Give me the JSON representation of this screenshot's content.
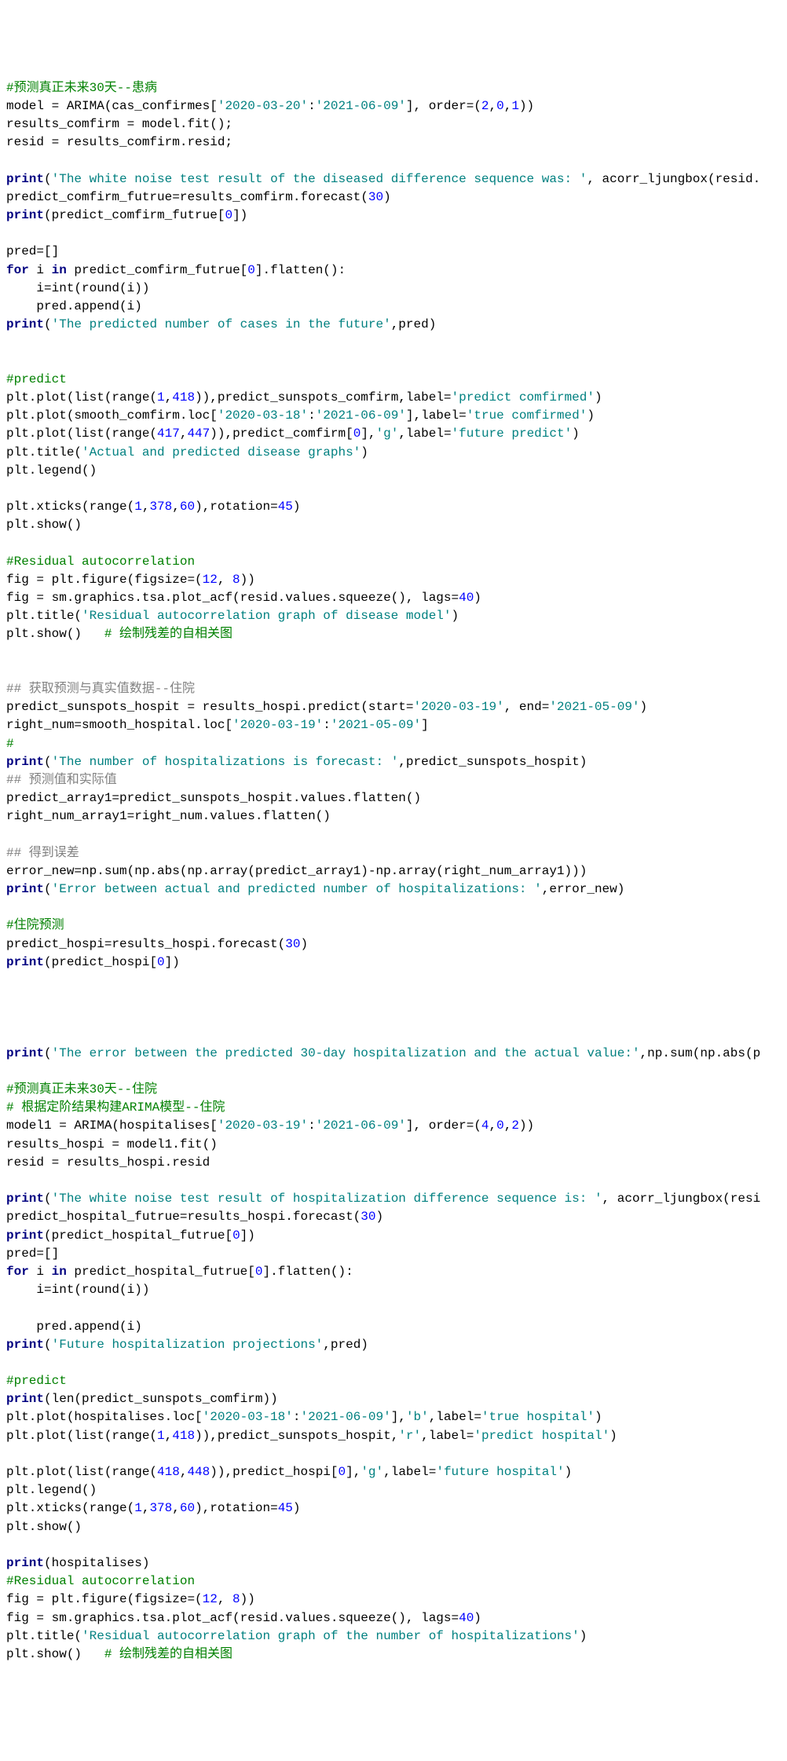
{
  "lines": [
    [
      [
        "c",
        "#预测真正未来30天--患病"
      ]
    ],
    [
      [
        "p",
        "model = ARIMA(cas_confirmes["
      ],
      [
        "s",
        "'2020-03-20'"
      ],
      [
        "p",
        ":"
      ],
      [
        "s",
        "'2021-06-09'"
      ],
      [
        "p",
        "], order=("
      ],
      [
        "n",
        "2"
      ],
      [
        "p",
        ","
      ],
      [
        "n",
        "0"
      ],
      [
        "p",
        ","
      ],
      [
        "n",
        "1"
      ],
      [
        "p",
        "))"
      ]
    ],
    [
      [
        "p",
        "results_comfirm = model.fit();"
      ]
    ],
    [
      [
        "p",
        "resid = results_comfirm.resid;"
      ]
    ],
    [],
    [
      [
        "k",
        "print"
      ],
      [
        "p",
        "("
      ],
      [
        "s",
        "'The white noise test result of the diseased difference sequence was: '"
      ],
      [
        "p",
        ", acorr_ljungbox(resid."
      ]
    ],
    [
      [
        "p",
        "predict_comfirm_futrue=results_comfirm.forecast("
      ],
      [
        "n",
        "30"
      ],
      [
        "p",
        ")"
      ]
    ],
    [
      [
        "k",
        "print"
      ],
      [
        "p",
        "(predict_comfirm_futrue["
      ],
      [
        "n",
        "0"
      ],
      [
        "p",
        "])"
      ]
    ],
    [],
    [
      [
        "p",
        "pred=[]"
      ]
    ],
    [
      [
        "k",
        "for"
      ],
      [
        "p",
        " i "
      ],
      [
        "k",
        "in"
      ],
      [
        "p",
        " predict_comfirm_futrue["
      ],
      [
        "n",
        "0"
      ],
      [
        "p",
        "].flatten():"
      ]
    ],
    [
      [
        "p",
        "    i=int(round(i))"
      ]
    ],
    [
      [
        "p",
        "    pred.append(i)"
      ]
    ],
    [
      [
        "k",
        "print"
      ],
      [
        "p",
        "("
      ],
      [
        "s",
        "'The predicted number of cases in the future'"
      ],
      [
        "p",
        ",pred)"
      ]
    ],
    [],
    [],
    [
      [
        "c",
        "#predict"
      ]
    ],
    [
      [
        "p",
        "plt.plot(list(range("
      ],
      [
        "n",
        "1"
      ],
      [
        "p",
        ","
      ],
      [
        "n",
        "418"
      ],
      [
        "p",
        ")),predict_sunspots_comfirm,label="
      ],
      [
        "s",
        "'predict comfirmed'"
      ],
      [
        "p",
        ")"
      ]
    ],
    [
      [
        "p",
        "plt.plot(smooth_comfirm.loc["
      ],
      [
        "s",
        "'2020-03-18'"
      ],
      [
        "p",
        ":"
      ],
      [
        "s",
        "'2021-06-09'"
      ],
      [
        "p",
        "],label="
      ],
      [
        "s",
        "'true comfirmed'"
      ],
      [
        "p",
        ")"
      ]
    ],
    [
      [
        "p",
        "plt.plot(list(range("
      ],
      [
        "n",
        "417"
      ],
      [
        "p",
        ","
      ],
      [
        "n",
        "447"
      ],
      [
        "p",
        ")),predict_comfirm["
      ],
      [
        "n",
        "0"
      ],
      [
        "p",
        "],"
      ],
      [
        "s",
        "'g'"
      ],
      [
        "p",
        ",label="
      ],
      [
        "s",
        "'future predict'"
      ],
      [
        "p",
        ")"
      ]
    ],
    [
      [
        "p",
        "plt.title("
      ],
      [
        "s",
        "'Actual and predicted disease graphs'"
      ],
      [
        "p",
        ")"
      ]
    ],
    [
      [
        "p",
        "plt.legend()"
      ]
    ],
    [],
    [
      [
        "p",
        "plt.xticks(range("
      ],
      [
        "n",
        "1"
      ],
      [
        "p",
        ","
      ],
      [
        "n",
        "378"
      ],
      [
        "p",
        ","
      ],
      [
        "n",
        "60"
      ],
      [
        "p",
        "),rotation="
      ],
      [
        "n",
        "45"
      ],
      [
        "p",
        ")"
      ]
    ],
    [
      [
        "p",
        "plt.show()"
      ]
    ],
    [],
    [
      [
        "c",
        "#Residual autocorrelation"
      ]
    ],
    [
      [
        "p",
        "fig = plt.figure(figsize=("
      ],
      [
        "n",
        "12"
      ],
      [
        "p",
        ", "
      ],
      [
        "n",
        "8"
      ],
      [
        "p",
        "))"
      ]
    ],
    [
      [
        "p",
        "fig = sm.graphics.tsa.plot_acf(resid.values.squeeze(), lags="
      ],
      [
        "n",
        "40"
      ],
      [
        "p",
        ")"
      ]
    ],
    [
      [
        "p",
        "plt.title("
      ],
      [
        "s",
        "'Residual autocorrelation graph of disease model'"
      ],
      [
        "p",
        ")"
      ]
    ],
    [
      [
        "p",
        "plt.show()   "
      ],
      [
        "c",
        "# 绘制残差的自相关图"
      ]
    ],
    [],
    [],
    [
      [
        "ss",
        "## 获取预测与真实值数据--住院"
      ]
    ],
    [
      [
        "p",
        "predict_sunspots_hospit = results_hospi.predict(start="
      ],
      [
        "s",
        "'2020-03-19'"
      ],
      [
        "p",
        ", end="
      ],
      [
        "s",
        "'2021-05-09'"
      ],
      [
        "p",
        ")"
      ]
    ],
    [
      [
        "p",
        "right_num=smooth_hospital.loc["
      ],
      [
        "s",
        "'2020-03-19'"
      ],
      [
        "p",
        ":"
      ],
      [
        "s",
        "'2021-05-09'"
      ],
      [
        "p",
        "]"
      ]
    ],
    [
      [
        "c",
        "#"
      ]
    ],
    [
      [
        "k",
        "print"
      ],
      [
        "p",
        "("
      ],
      [
        "s",
        "'The number of hospitalizations is forecast: '"
      ],
      [
        "p",
        ",predict_sunspots_hospit)"
      ]
    ],
    [
      [
        "ss",
        "## 预测值和实际值"
      ]
    ],
    [
      [
        "p",
        "predict_array1=predict_sunspots_hospit.values.flatten()"
      ]
    ],
    [
      [
        "p",
        "right_num_array1=right_num.values.flatten()"
      ]
    ],
    [],
    [
      [
        "ss",
        "## 得到误差"
      ]
    ],
    [
      [
        "p",
        "error_new=np.sum(np.abs(np.array(predict_array1)-np.array(right_num_array1)))"
      ]
    ],
    [
      [
        "k",
        "print"
      ],
      [
        "p",
        "("
      ],
      [
        "s",
        "'Error between actual and predicted number of hospitalizations: '"
      ],
      [
        "p",
        ",error_new)"
      ]
    ],
    [],
    [
      [
        "c",
        "#住院预测"
      ]
    ],
    [
      [
        "p",
        "predict_hospi=results_hospi.forecast("
      ],
      [
        "n",
        "30"
      ],
      [
        "p",
        ")"
      ]
    ],
    [
      [
        "k",
        "print"
      ],
      [
        "p",
        "(predict_hospi["
      ],
      [
        "n",
        "0"
      ],
      [
        "p",
        "])"
      ]
    ],
    [],
    [],
    [],
    [],
    [
      [
        "k",
        "print"
      ],
      [
        "p",
        "("
      ],
      [
        "s",
        "'The error between the predicted 30-day hospitalization and the actual value:'"
      ],
      [
        "p",
        ",np.sum(np.abs(p"
      ]
    ],
    [],
    [
      [
        "c",
        "#预测真正未来30天--住院"
      ]
    ],
    [
      [
        "c",
        "# 根据定阶结果构建ARIMA模型--住院"
      ]
    ],
    [
      [
        "p",
        "model1 = ARIMA(hospitalises["
      ],
      [
        "s",
        "'2020-03-19'"
      ],
      [
        "p",
        ":"
      ],
      [
        "s",
        "'2021-06-09'"
      ],
      [
        "p",
        "], order=("
      ],
      [
        "n",
        "4"
      ],
      [
        "p",
        ","
      ],
      [
        "n",
        "0"
      ],
      [
        "p",
        ","
      ],
      [
        "n",
        "2"
      ],
      [
        "p",
        "))"
      ]
    ],
    [
      [
        "p",
        "results_hospi = model1.fit()"
      ]
    ],
    [
      [
        "p",
        "resid = results_hospi.resid"
      ]
    ],
    [],
    [
      [
        "k",
        "print"
      ],
      [
        "p",
        "("
      ],
      [
        "s",
        "'The white noise test result of hospitalization difference sequence is: '"
      ],
      [
        "p",
        ", acorr_ljungbox(resi"
      ]
    ],
    [
      [
        "p",
        "predict_hospital_futrue=results_hospi.forecast("
      ],
      [
        "n",
        "30"
      ],
      [
        "p",
        ")"
      ]
    ],
    [
      [
        "k",
        "print"
      ],
      [
        "p",
        "(predict_hospital_futrue["
      ],
      [
        "n",
        "0"
      ],
      [
        "p",
        "])"
      ]
    ],
    [
      [
        "p",
        "pred=[]"
      ]
    ],
    [
      [
        "k",
        "for"
      ],
      [
        "p",
        " i "
      ],
      [
        "k",
        "in"
      ],
      [
        "p",
        " predict_hospital_futrue["
      ],
      [
        "n",
        "0"
      ],
      [
        "p",
        "].flatten():"
      ]
    ],
    [
      [
        "p",
        "    i=int(round(i))"
      ]
    ],
    [],
    [
      [
        "p",
        "    pred.append(i)"
      ]
    ],
    [
      [
        "k",
        "print"
      ],
      [
        "p",
        "("
      ],
      [
        "s",
        "'Future hospitalization projections'"
      ],
      [
        "p",
        ",pred)"
      ]
    ],
    [],
    [
      [
        "c",
        "#predict"
      ]
    ],
    [
      [
        "k",
        "print"
      ],
      [
        "p",
        "(len(predict_sunspots_comfirm))"
      ]
    ],
    [
      [
        "p",
        "plt.plot(hospitalises.loc["
      ],
      [
        "s",
        "'2020-03-18'"
      ],
      [
        "p",
        ":"
      ],
      [
        "s",
        "'2021-06-09'"
      ],
      [
        "p",
        "],"
      ],
      [
        "s",
        "'b'"
      ],
      [
        "p",
        ",label="
      ],
      [
        "s",
        "'true hospital'"
      ],
      [
        "p",
        ")"
      ]
    ],
    [
      [
        "p",
        "plt.plot(list(range("
      ],
      [
        "n",
        "1"
      ],
      [
        "p",
        ","
      ],
      [
        "n",
        "418"
      ],
      [
        "p",
        ")),predict_sunspots_hospit,"
      ],
      [
        "s",
        "'r'"
      ],
      [
        "p",
        ",label="
      ],
      [
        "s",
        "'predict hospital'"
      ],
      [
        "p",
        ")"
      ]
    ],
    [],
    [
      [
        "p",
        "plt.plot(list(range("
      ],
      [
        "n",
        "418"
      ],
      [
        "p",
        ","
      ],
      [
        "n",
        "448"
      ],
      [
        "p",
        ")),predict_hospi["
      ],
      [
        "n",
        "0"
      ],
      [
        "p",
        "],"
      ],
      [
        "s",
        "'g'"
      ],
      [
        "p",
        ",label="
      ],
      [
        "s",
        "'future hospital'"
      ],
      [
        "p",
        ")"
      ]
    ],
    [
      [
        "p",
        "plt.legend()"
      ]
    ],
    [
      [
        "p",
        "plt.xticks(range("
      ],
      [
        "n",
        "1"
      ],
      [
        "p",
        ","
      ],
      [
        "n",
        "378"
      ],
      [
        "p",
        ","
      ],
      [
        "n",
        "60"
      ],
      [
        "p",
        "),rotation="
      ],
      [
        "n",
        "45"
      ],
      [
        "p",
        ")"
      ]
    ],
    [
      [
        "p",
        "plt.show()"
      ]
    ],
    [],
    [
      [
        "k",
        "print"
      ],
      [
        "p",
        "(hospitalises)"
      ]
    ],
    [
      [
        "c",
        "#Residual autocorrelation"
      ]
    ],
    [
      [
        "p",
        "fig = plt.figure(figsize=("
      ],
      [
        "n",
        "12"
      ],
      [
        "p",
        ", "
      ],
      [
        "n",
        "8"
      ],
      [
        "p",
        "))"
      ]
    ],
    [
      [
        "p",
        "fig = sm.graphics.tsa.plot_acf(resid.values.squeeze(), lags="
      ],
      [
        "n",
        "40"
      ],
      [
        "p",
        ")"
      ]
    ],
    [
      [
        "p",
        "plt.title("
      ],
      [
        "s",
        "'Residual autocorrelation graph of the number of hospitalizations'"
      ],
      [
        "p",
        ")"
      ]
    ],
    [
      [
        "p",
        "plt.show()   "
      ],
      [
        "c",
        "# 绘制残差的自相关图"
      ]
    ]
  ]
}
